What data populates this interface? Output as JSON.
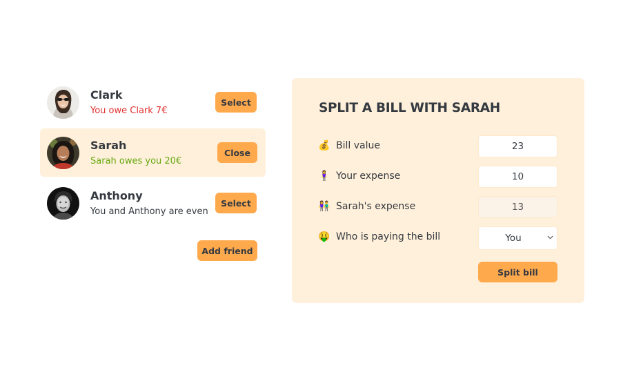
{
  "friends": [
    {
      "name": "Clark",
      "status": "You owe Clark 7€",
      "status_color": "#e03131",
      "button_label": "Select",
      "selected": false
    },
    {
      "name": "Sarah",
      "status": "Sarah owes you 20€",
      "status_color": "#66a80f",
      "button_label": "Close",
      "selected": true
    },
    {
      "name": "Anthony",
      "status": "You and Anthony are even",
      "status_color": "#343a40",
      "button_label": "Select",
      "selected": false
    }
  ],
  "add_friend_label": "Add friend",
  "form": {
    "title": "SPLIT A BILL WITH SARAH",
    "bill_value": {
      "icon": "💰",
      "label": "Bill value",
      "value": "23"
    },
    "your_expense": {
      "icon": "🧍‍♀️",
      "label": "Your expense",
      "value": "10"
    },
    "friend_expense": {
      "icon": "👫",
      "label": "Sarah's expense",
      "value": "13"
    },
    "payer": {
      "icon": "🤑",
      "label": "Who is paying the bill",
      "selected": "You"
    },
    "submit_label": "Split bill"
  },
  "colors": {
    "accent": "#ffa94d",
    "panel_bg": "#fff0db",
    "owe_red": "#e03131",
    "owed_green": "#66a80f",
    "text": "#343a40"
  }
}
